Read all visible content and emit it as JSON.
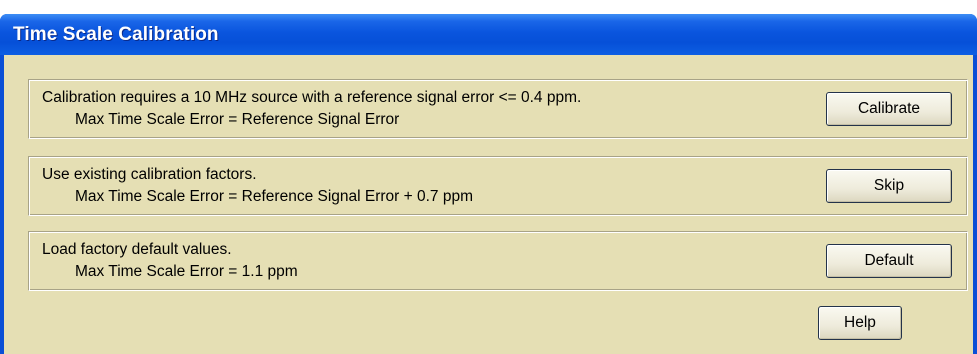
{
  "window": {
    "title": "Time Scale Calibration"
  },
  "options": [
    {
      "line1": "Calibration requires a 10 MHz source with a reference signal error <= 0.4 ppm.",
      "line2": "Max Time Scale Error = Reference Signal Error",
      "button_label": "Calibrate"
    },
    {
      "line1": "Use existing calibration factors.",
      "line2": "Max Time Scale Error = Reference Signal Error + 0.7 ppm",
      "button_label": "Skip"
    },
    {
      "line1": "Load factory default values.",
      "line2": "Max Time Scale Error = 1.1 ppm",
      "button_label": "Default"
    }
  ],
  "help_label": "Help",
  "colors": {
    "titlebar": "#0a55de",
    "client_background": "#e5dfb4",
    "title_text": "#ffffff"
  }
}
